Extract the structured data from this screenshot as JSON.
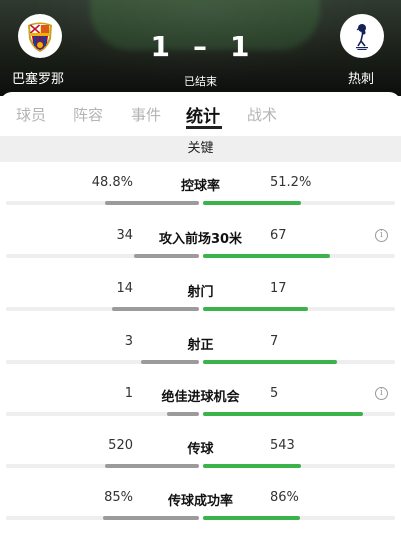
{
  "match": {
    "home_team": "巴塞罗那",
    "away_team": "热刺",
    "home_score": "1",
    "away_score": "1",
    "separator": "–",
    "status": "已结束",
    "home_crest_icon": "barcelona-crest-icon",
    "away_crest_icon": "tottenham-crest-icon"
  },
  "tabs": [
    {
      "label": "球员",
      "active": false
    },
    {
      "label": "阵容",
      "active": false
    },
    {
      "label": "事件",
      "active": false
    },
    {
      "label": "统计",
      "active": true
    },
    {
      "label": "战术",
      "active": false
    }
  ],
  "section_title": "关键",
  "colors": {
    "home_bar": "#9b9b9b",
    "away_bar": "#3bb24a",
    "track": "#eeeeee"
  },
  "stats": [
    {
      "label": "控球率",
      "home": "48.8%",
      "away": "51.2%",
      "home_num": 48.8,
      "away_num": 51.2,
      "info": false
    },
    {
      "label": "攻入前场30米",
      "home": "34",
      "away": "67",
      "home_num": 34,
      "away_num": 67,
      "info": true
    },
    {
      "label": "射门",
      "home": "14",
      "away": "17",
      "home_num": 14,
      "away_num": 17,
      "info": false
    },
    {
      "label": "射正",
      "home": "3",
      "away": "7",
      "home_num": 3,
      "away_num": 7,
      "info": false
    },
    {
      "label": "绝佳进球机会",
      "home": "1",
      "away": "5",
      "home_num": 1,
      "away_num": 5,
      "info": true
    },
    {
      "label": "传球",
      "home": "520",
      "away": "543",
      "home_num": 520,
      "away_num": 543,
      "info": false
    },
    {
      "label": "传球成功率",
      "home": "85%",
      "away": "86%",
      "home_num": 85,
      "away_num": 86,
      "info": false
    }
  ],
  "info_icon": "info-icon",
  "info_glyph": "i"
}
